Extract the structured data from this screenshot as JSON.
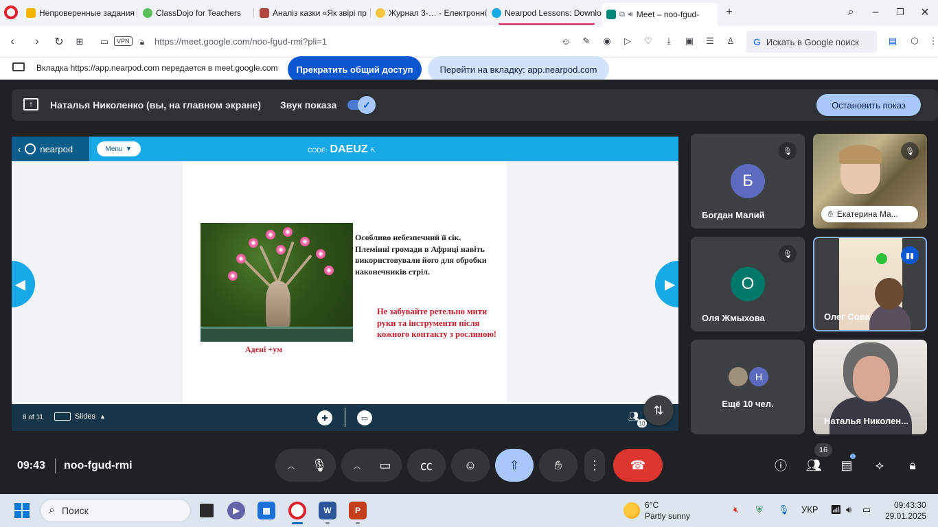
{
  "browser": {
    "tabs": [
      {
        "title": "Непроверенные задания",
        "favicon_color": "#f4b400"
      },
      {
        "title": "ClassDojo for Teachers",
        "favicon_color": "#5ac05a"
      },
      {
        "title": "Аналіз казки «Як звірі пр",
        "favicon_color": "#b0463e"
      },
      {
        "title": "Журнал 3-… - Електронні",
        "favicon_color": "#f5c542"
      },
      {
        "title": "Nearpod Lessons: Downlo",
        "favicon_color": "#17a8e8"
      },
      {
        "title": "Meet – noo-fgud-",
        "favicon_color": "#00897b",
        "active": true
      }
    ],
    "new_tab": "+",
    "url": "https://meet.google.com/noo-fgud-rmi?pli=1",
    "vpn": "VPN",
    "search_placeholder": "Искать в Google поиск"
  },
  "share_banner": {
    "text": "Вкладка https://app.nearpod.com передается в meet.google.com",
    "stop_label": "Прекратить общий доступ",
    "goto_label": "Перейти на вкладку: app.nearpod.com"
  },
  "presenting": {
    "name": "Наталья Николенко (вы, на главном экране)",
    "sound_label": "Звук показа",
    "sound_on": true,
    "stop_label": "Остановить показ"
  },
  "nearpod": {
    "logo": "nearpod",
    "menu": "Menu",
    "code_label": "CODE:",
    "code": "DAEUZ",
    "slide": {
      "caption": "Адені +ум",
      "text": "Особливо небезпечний її сік. Племінні громади в Африці навіть використовували його для обробки наконечників стріл.",
      "warning": "Не забувайте ретельно мити руки та інструменти після кожного контакту з рослиною!"
    },
    "page_indicator": "8 of 11",
    "slides_label": "Slides",
    "people_count": "10"
  },
  "participants": [
    {
      "name": "Богдан Малий",
      "initial": "Б",
      "color": "#5c6bc0",
      "muted": true
    },
    {
      "name": "Екатерина Ма...",
      "video": true,
      "muted": true
    },
    {
      "name": "Оля Жмыхова",
      "initial": "О",
      "color": "#00796b",
      "muted": true
    },
    {
      "name": "Олег Сова",
      "video": true,
      "speaking": true
    },
    {
      "name": "Ещё 10 чел.",
      "initial": "Н",
      "color": "#5c6bc0"
    },
    {
      "name": "Наталья Николен...",
      "video": true
    }
  ],
  "controls": {
    "time": "09:43",
    "meeting_code": "noo-fgud-rmi",
    "people_badge": "16"
  },
  "taskbar": {
    "search_label": "Поиск",
    "weather_temp": "6°C",
    "weather_desc": "Partly sunny",
    "language": "УКР",
    "time": "09:43:30",
    "date": "29.01.2025"
  }
}
